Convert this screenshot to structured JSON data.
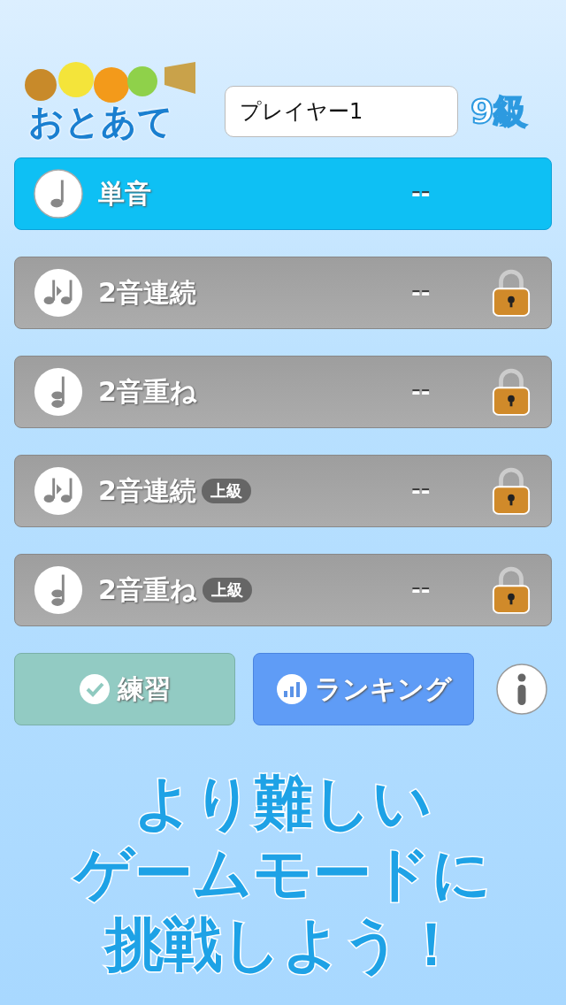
{
  "header": {
    "logo_text": "おとあて",
    "player_name": "プレイヤー1",
    "rank": "9級"
  },
  "modes": [
    {
      "kind": "single",
      "label": "単音",
      "score": "--",
      "selected": true,
      "locked": false
    },
    {
      "kind": "sequence",
      "label": "2音連続",
      "score": "--",
      "selected": false,
      "locked": true
    },
    {
      "kind": "chord",
      "label": "2音重ね",
      "score": "--",
      "selected": false,
      "locked": true
    },
    {
      "kind": "sequence",
      "label": "2音連続",
      "badge": "上級",
      "score": "--",
      "selected": false,
      "locked": true
    },
    {
      "kind": "chord",
      "label": "2音重ね",
      "badge": "上級",
      "score": "--",
      "selected": false,
      "locked": true
    }
  ],
  "buttons": {
    "practice": "練習",
    "ranking": "ランキング"
  },
  "promo": [
    "より難しい",
    "ゲームモードに",
    "挑戦しよう！"
  ]
}
